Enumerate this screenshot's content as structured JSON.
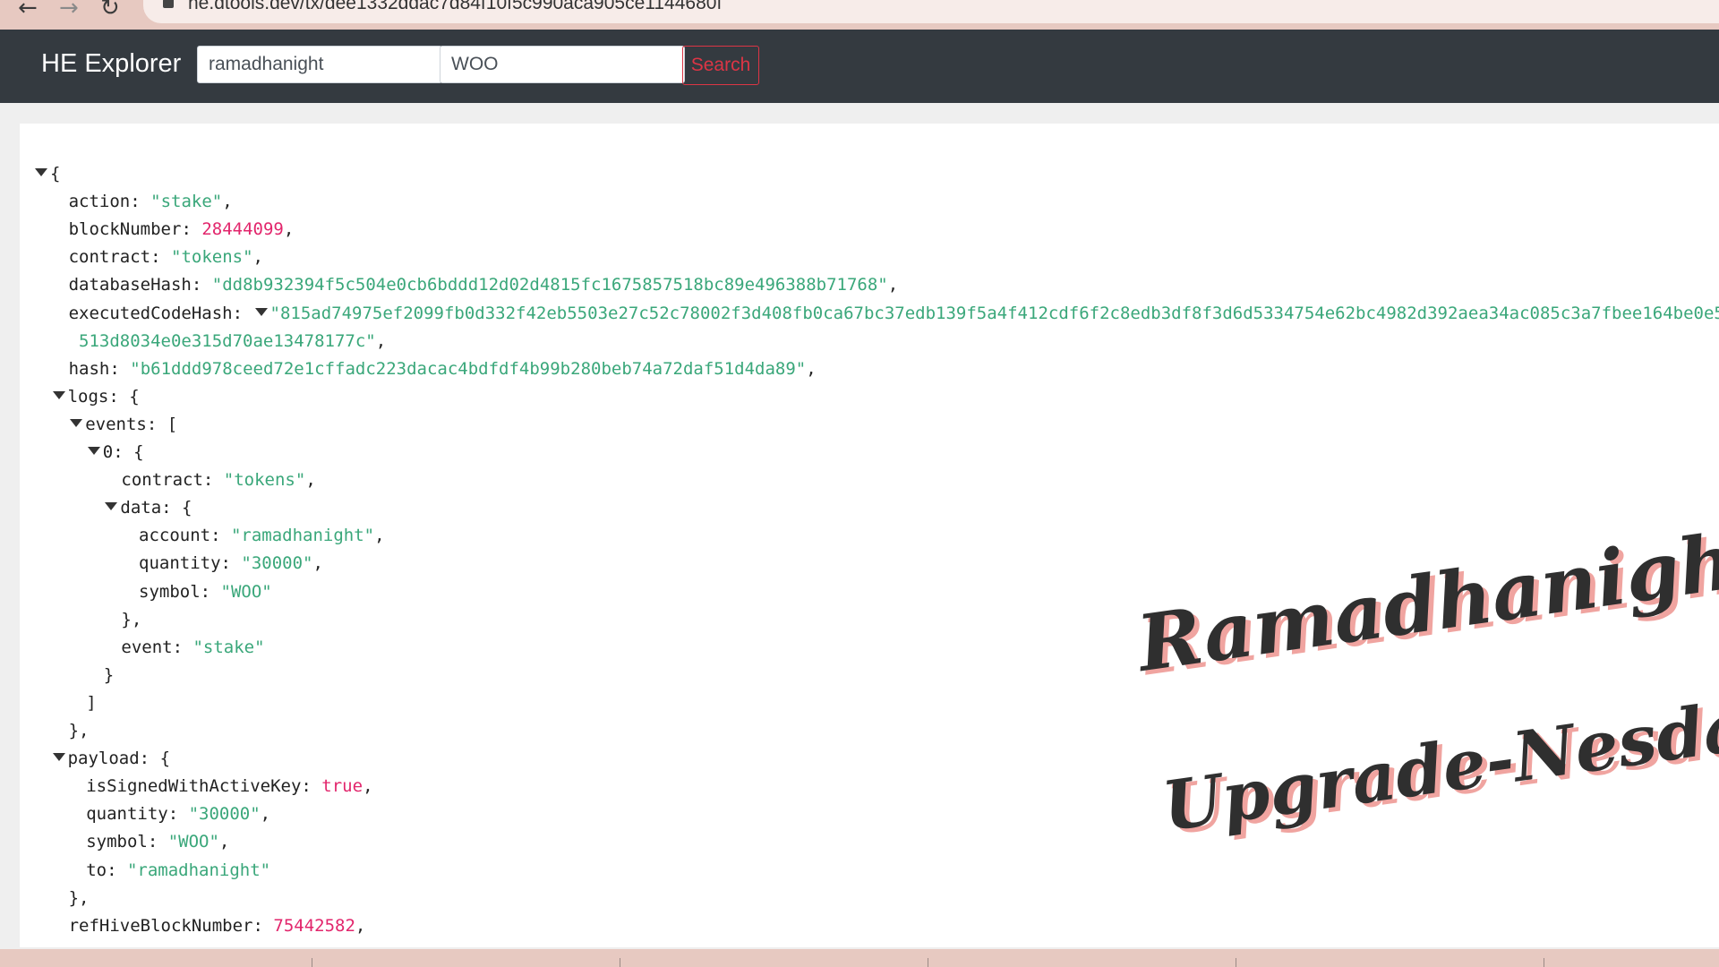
{
  "browser": {
    "url": "he.dtools.dev/tx/dee1332ddac7d84f10f5c990aca905ce1144680f",
    "back_glyph": "←",
    "forward_glyph": "→",
    "reload_glyph": "↻"
  },
  "navbar": {
    "brand": "HE Explorer",
    "account_value": "ramadhanight",
    "token_value": "WOO",
    "search_label": "Search"
  },
  "json_lines": [
    {
      "i": 0,
      "tri": true,
      "key": "",
      "sep": "",
      "val": "{",
      "type": "punct",
      "trail": ""
    },
    {
      "i": 1,
      "tri": false,
      "key": "action",
      "sep": ": ",
      "val": "\"stake\"",
      "type": "str",
      "trail": ","
    },
    {
      "i": 1,
      "tri": false,
      "key": "blockNumber",
      "sep": ": ",
      "val": "28444099",
      "type": "num",
      "trail": ","
    },
    {
      "i": 1,
      "tri": false,
      "key": "contract",
      "sep": ": ",
      "val": "\"tokens\"",
      "type": "str",
      "trail": ","
    },
    {
      "i": 1,
      "tri": false,
      "key": "databaseHash",
      "sep": ": ",
      "val": "\"dd8b932394f5c504e0cb6bddd12d02d4815fc1675857518bc89e496388b71768\"",
      "type": "str",
      "trail": ","
    },
    {
      "i": 1,
      "tri": false,
      "key": "executedCodeHash",
      "sep": ": ",
      "tri_inline": true,
      "val": "\"815ad74975ef2099fb0d332f42eb5503e27c52c78002f3d408fb0ca67bc37edb139f5a4f412cdf6f2c8edb3df8f3d6d5334754e62bc4982d392aea34ac085c3a7fbee164be0e5",
      "type": "str",
      "trail": ""
    },
    {
      "i": 1,
      "tri": false,
      "key": "",
      "sep": "",
      "val": "513d8034e0e315d70ae13478177c\"",
      "type": "str",
      "trail": ","
    },
    {
      "i": 1,
      "tri": false,
      "key": "hash",
      "sep": ": ",
      "val": "\"b61ddd978ceed72e1cffadc223dacac4bdfdf4b99b280beb74a72daf51d4da89\"",
      "type": "str",
      "trail": ","
    },
    {
      "i": 1,
      "tri": true,
      "key": "logs",
      "sep": ": ",
      "val": "{",
      "type": "punct",
      "trail": ""
    },
    {
      "i": 2,
      "tri": true,
      "key": "events",
      "sep": ": ",
      "val": "[",
      "type": "punct",
      "trail": ""
    },
    {
      "i": 3,
      "tri": true,
      "key": "0",
      "sep": ": ",
      "val": "{",
      "type": "punct",
      "trail": ""
    },
    {
      "i": 4,
      "tri": false,
      "key": "contract",
      "sep": ": ",
      "val": "\"tokens\"",
      "type": "str",
      "trail": ","
    },
    {
      "i": 4,
      "tri": true,
      "key": "data",
      "sep": ": ",
      "val": "{",
      "type": "punct",
      "trail": ""
    },
    {
      "i": 5,
      "tri": false,
      "key": "account",
      "sep": ": ",
      "val": "\"ramadhanight\"",
      "type": "str",
      "trail": ","
    },
    {
      "i": 5,
      "tri": false,
      "key": "quantity",
      "sep": ": ",
      "val": "\"30000\"",
      "type": "str",
      "trail": ","
    },
    {
      "i": 5,
      "tri": false,
      "key": "symbol",
      "sep": ": ",
      "val": "\"WOO\"",
      "type": "str",
      "trail": ""
    },
    {
      "i": 4,
      "tri": false,
      "key": "",
      "sep": "",
      "val": "},",
      "type": "punct",
      "trail": ""
    },
    {
      "i": 4,
      "tri": false,
      "key": "event",
      "sep": ": ",
      "val": "\"stake\"",
      "type": "str",
      "trail": ""
    },
    {
      "i": 3,
      "tri": false,
      "key": "",
      "sep": "",
      "val": "}",
      "type": "punct",
      "trail": ""
    },
    {
      "i": 2,
      "tri": false,
      "key": "",
      "sep": "",
      "val": "]",
      "type": "punct",
      "trail": ""
    },
    {
      "i": 1,
      "tri": false,
      "key": "",
      "sep": "",
      "val": "},",
      "type": "punct",
      "trail": ""
    },
    {
      "i": 1,
      "tri": true,
      "key": "payload",
      "sep": ": ",
      "val": "{",
      "type": "punct",
      "trail": ""
    },
    {
      "i": 2,
      "tri": false,
      "key": "isSignedWithActiveKey",
      "sep": ": ",
      "val": "true",
      "type": "bool",
      "trail": ","
    },
    {
      "i": 2,
      "tri": false,
      "key": "quantity",
      "sep": ": ",
      "val": "\"30000\"",
      "type": "str",
      "trail": ","
    },
    {
      "i": 2,
      "tri": false,
      "key": "symbol",
      "sep": ": ",
      "val": "\"WOO\"",
      "type": "str",
      "trail": ","
    },
    {
      "i": 2,
      "tri": false,
      "key": "to",
      "sep": ": ",
      "val": "\"ramadhanight\"",
      "type": "str",
      "trail": ""
    },
    {
      "i": 1,
      "tri": false,
      "key": "",
      "sep": "",
      "val": "},",
      "type": "punct",
      "trail": ""
    },
    {
      "i": 1,
      "tri": false,
      "key": "refHiveBlockNumber",
      "sep": ": ",
      "val": "75442582",
      "type": "num",
      "trail": ","
    }
  ],
  "overlay": {
    "line1": "Ramadhanight",
    "line2": "Upgrade-Nesday"
  },
  "colors": {
    "navbar": "#343a40",
    "string": "#3aa77a",
    "number": "#e2266c",
    "search_border": "#dc3545"
  }
}
